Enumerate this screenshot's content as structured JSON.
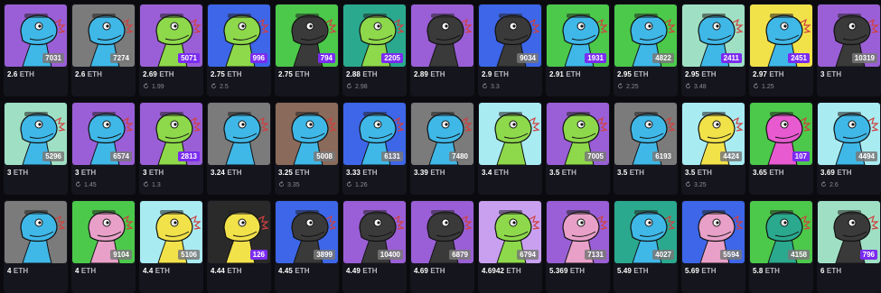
{
  "currency": "ETH",
  "rows": [
    [
      {
        "bg": "#9a5fd6",
        "skin": "#3fb8e8",
        "badge": "7031",
        "listed": false,
        "price": "2.6",
        "last": ""
      },
      {
        "bg": "#7b7b7b",
        "skin": "#3fb8e8",
        "badge": "7274",
        "listed": false,
        "price": "2.6",
        "last": ""
      },
      {
        "bg": "#9a5fd6",
        "skin": "#8ed94b",
        "badge": "5071",
        "listed": true,
        "price": "2.69",
        "last": "1.99"
      },
      {
        "bg": "#3d66e8",
        "skin": "#8ed94b",
        "badge": "996",
        "listed": true,
        "price": "2.75",
        "last": "2.5"
      },
      {
        "bg": "#4cc94a",
        "skin": "#3a3a3a",
        "badge": "794",
        "listed": true,
        "price": "2.75",
        "last": ""
      },
      {
        "bg": "#2aa98e",
        "skin": "#8ed94b",
        "badge": "2205",
        "listed": true,
        "price": "2.88",
        "last": "2.98"
      },
      {
        "bg": "#9a5fd6",
        "skin": "#3a3a3a",
        "badge": "",
        "listed": false,
        "price": "2.89",
        "last": ""
      },
      {
        "bg": "#3d66e8",
        "skin": "#3a3a3a",
        "badge": "9034",
        "listed": false,
        "price": "2.9",
        "last": "3.3"
      },
      {
        "bg": "#4cc94a",
        "skin": "#3fb8e8",
        "badge": "1931",
        "listed": true,
        "price": "2.91",
        "last": ""
      },
      {
        "bg": "#4cc94a",
        "skin": "#3fb8e8",
        "badge": "4822",
        "listed": false,
        "price": "2.95",
        "last": "2.25"
      },
      {
        "bg": "#9fe0c4",
        "skin": "#3fb8e8",
        "badge": "2411",
        "listed": true,
        "price": "2.95",
        "last": "3.48"
      },
      {
        "bg": "#f2e24a",
        "skin": "#3fb8e8",
        "badge": "2451",
        "listed": true,
        "price": "2.97",
        "last": "1.25"
      },
      {
        "bg": "#9a5fd6",
        "skin": "#3a3a3a",
        "badge": "10319",
        "listed": false,
        "price": "3",
        "last": ""
      }
    ],
    [
      {
        "bg": "#9fe0c4",
        "skin": "#3fb8e8",
        "badge": "5296",
        "listed": false,
        "price": "3",
        "last": ""
      },
      {
        "bg": "#9a5fd6",
        "skin": "#3fb8e8",
        "badge": "6574",
        "listed": false,
        "price": "3",
        "last": "1.45"
      },
      {
        "bg": "#9a5fd6",
        "skin": "#8ed94b",
        "badge": "2813",
        "listed": true,
        "price": "3",
        "last": "1.3"
      },
      {
        "bg": "#7b7b7b",
        "skin": "#3fb8e8",
        "badge": "",
        "listed": false,
        "price": "3.24",
        "last": ""
      },
      {
        "bg": "#8a6a5a",
        "skin": "#3fb8e8",
        "badge": "5008",
        "listed": false,
        "price": "3.25",
        "last": "3.35"
      },
      {
        "bg": "#3d66e8",
        "skin": "#3fb8e8",
        "badge": "6131",
        "listed": false,
        "price": "3.33",
        "last": "1.26"
      },
      {
        "bg": "#7b7b7b",
        "skin": "#3fb8e8",
        "badge": "7480",
        "listed": false,
        "price": "3.39",
        "last": ""
      },
      {
        "bg": "#a8ecf2",
        "skin": "#8ed94b",
        "badge": "",
        "listed": false,
        "price": "3.4",
        "last": ""
      },
      {
        "bg": "#9a5fd6",
        "skin": "#8ed94b",
        "badge": "7005",
        "listed": false,
        "price": "3.5",
        "last": ""
      },
      {
        "bg": "#7b7b7b",
        "skin": "#3fb8e8",
        "badge": "6193",
        "listed": false,
        "price": "3.5",
        "last": ""
      },
      {
        "bg": "#a8ecf2",
        "skin": "#f2e24a",
        "badge": "4424",
        "listed": false,
        "price": "3.5",
        "last": "3.25"
      },
      {
        "bg": "#4cc94a",
        "skin": "#e85ad0",
        "badge": "107",
        "listed": true,
        "price": "3.65",
        "last": ""
      },
      {
        "bg": "#a8ecf2",
        "skin": "#3fb8e8",
        "badge": "4494",
        "listed": false,
        "price": "3.69",
        "last": "2.6"
      }
    ],
    [
      {
        "bg": "#7b7b7b",
        "skin": "#3fb8e8",
        "badge": "",
        "listed": false,
        "price": "4",
        "last": ""
      },
      {
        "bg": "#4cc94a",
        "skin": "#e8a0c8",
        "badge": "9104",
        "listed": false,
        "price": "4",
        "last": ""
      },
      {
        "bg": "#a8ecf2",
        "skin": "#f2e24a",
        "badge": "5106",
        "listed": false,
        "price": "4.4",
        "last": ""
      },
      {
        "bg": "#2a2a2a",
        "skin": "#f2e24a",
        "badge": "126",
        "listed": true,
        "price": "4.44",
        "last": ""
      },
      {
        "bg": "#3d66e8",
        "skin": "#3a3a3a",
        "badge": "3899",
        "listed": false,
        "price": "4.45",
        "last": ""
      },
      {
        "bg": "#9a5fd6",
        "skin": "#3a3a3a",
        "badge": "10400",
        "listed": false,
        "price": "4.49",
        "last": ""
      },
      {
        "bg": "#9a5fd6",
        "skin": "#3a3a3a",
        "badge": "6879",
        "listed": false,
        "price": "4.69",
        "last": ""
      },
      {
        "bg": "#c9a0f0",
        "skin": "#8ed94b",
        "badge": "6794",
        "listed": false,
        "price": "4.6942",
        "last": ""
      },
      {
        "bg": "#9a5fd6",
        "skin": "#e8a0c8",
        "badge": "7131",
        "listed": false,
        "price": "5.369",
        "last": ""
      },
      {
        "bg": "#2aa98e",
        "skin": "#3fb8e8",
        "badge": "4027",
        "listed": false,
        "price": "5.49",
        "last": ""
      },
      {
        "bg": "#3d66e8",
        "skin": "#e8a0c8",
        "badge": "5594",
        "listed": false,
        "price": "5.69",
        "last": ""
      },
      {
        "bg": "#4cc94a",
        "skin": "#2aa98e",
        "badge": "4158",
        "listed": false,
        "price": "5.8",
        "last": ""
      },
      {
        "bg": "#9fe0c4",
        "skin": "#3a3a3a",
        "badge": "796",
        "listed": true,
        "price": "6",
        "last": ""
      }
    ]
  ]
}
